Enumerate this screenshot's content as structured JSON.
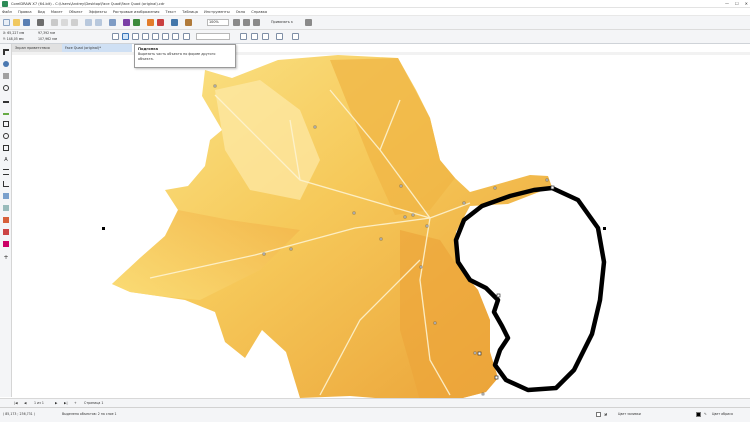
{
  "window": {
    "title": "CorelDRAW X7 (64-bit) - C:\\Users\\Andrey\\Desktop\\Face Quad\\Face Quad (original).cdr",
    "minimize": "—",
    "maximize": "☐",
    "close": "✕"
  },
  "menu": [
    "Файл",
    "Правка",
    "Вид",
    "Макет",
    "Объект",
    "Эффекты",
    "Растровые изображения",
    "Текст",
    "Таблица",
    "Инструменты",
    "Окно",
    "Справка"
  ],
  "standard_toolbar": {
    "zoom_value": "100%",
    "snap_label": "Привязать к"
  },
  "property_bar": {
    "x_value": "X: 65,227 мм",
    "y_value": "Y: 148,05 мм",
    "w_value": "97,392 мм",
    "h_value": "107,962 мм"
  },
  "tooltip": {
    "title": "Подгонка",
    "body": "Вырезать часть объекта по форме другого объекта."
  },
  "document_tabs": [
    "Экран приветствия",
    "Face Quad (original)*"
  ],
  "page_navigator": {
    "position": "1 из 1",
    "page_tab": "Страница 1"
  },
  "status_bar": {
    "coordinates": "( 85,173 ; 236,731 )",
    "selection_info": "Выделено объектов: 2 на слое 1",
    "fill_label": "Цвет заливки",
    "outline_label": "Цвет абриса"
  },
  "colors": {
    "toolbar_bg": "#f4f5f7",
    "leaf_light": "#fbe07a",
    "leaf_mid": "#f5c14e",
    "leaf_dark": "#e59a2e",
    "outline_black": "#000000"
  }
}
